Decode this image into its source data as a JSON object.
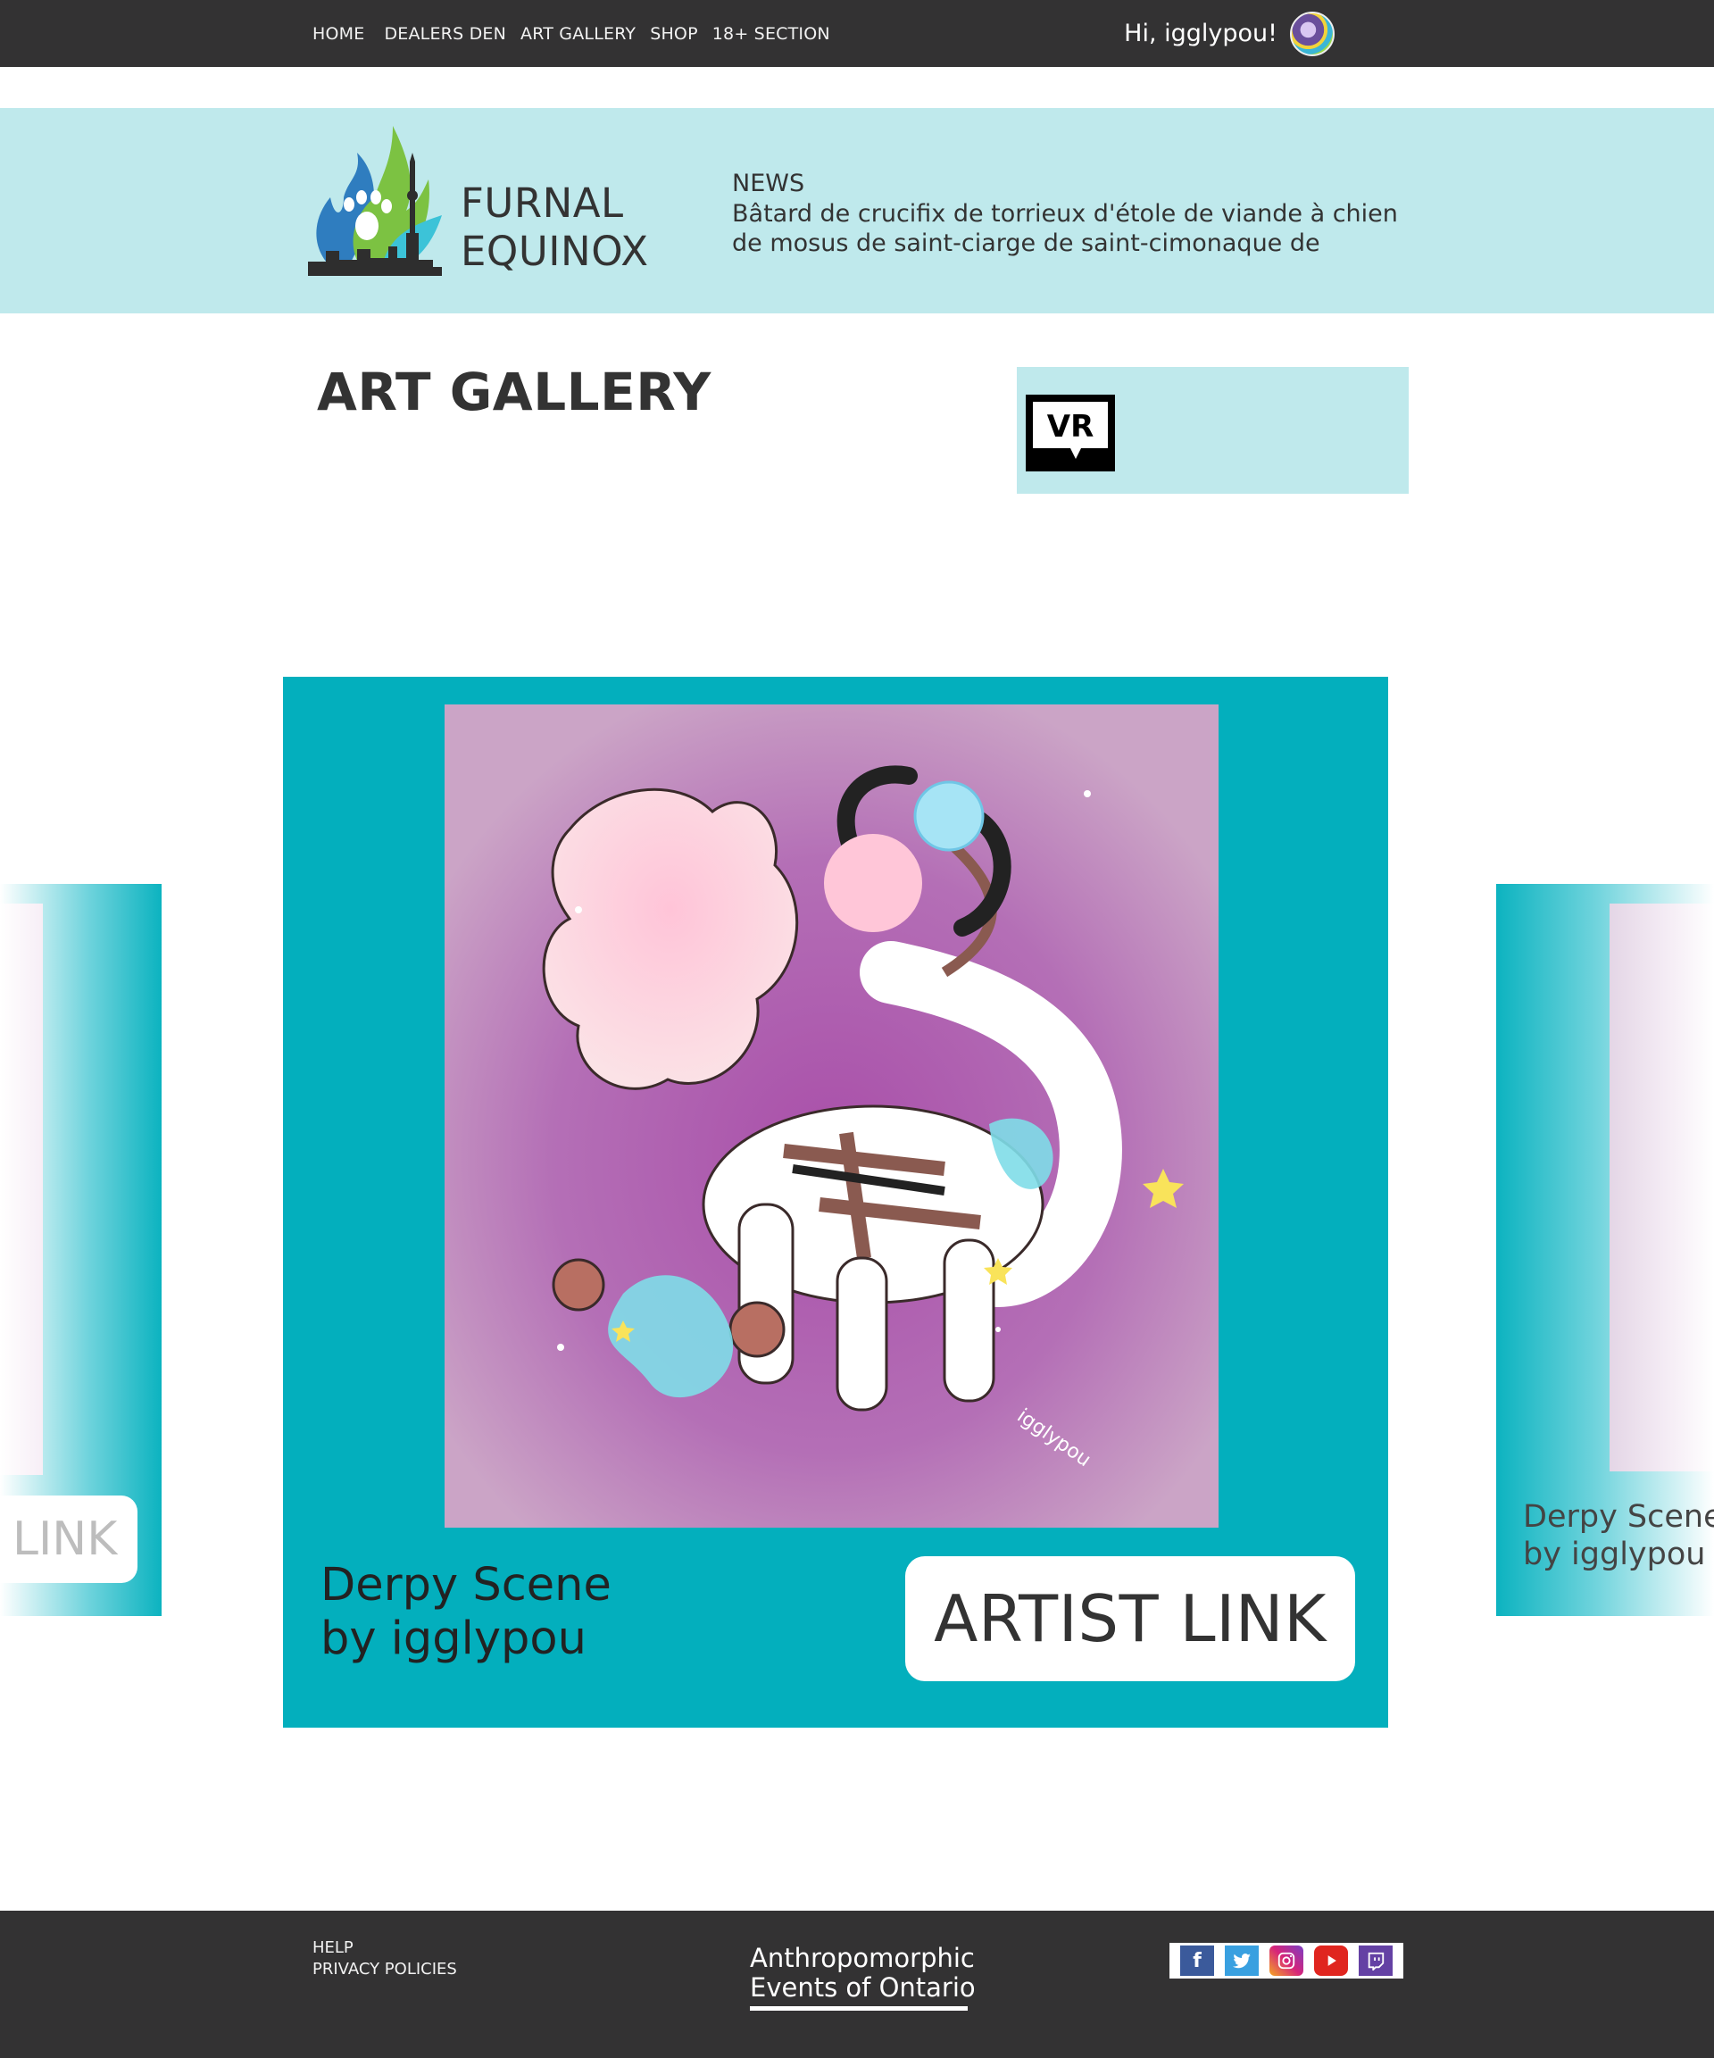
{
  "nav": {
    "items": [
      "HOME",
      "DEALERS DEN",
      "ART GALLERY",
      "SHOP",
      "18+ SECTION"
    ],
    "greeting": "Hi, igglypou!"
  },
  "header": {
    "brand_line1": "FURNAL",
    "brand_line2": "EQUINOX",
    "news_title": "NEWS",
    "news_body": "Bâtard de crucifix de torrieux d'étole de viande à chien de mosus de saint-ciarge de saint-cimonaque de"
  },
  "page": {
    "title": "ART GALLERY",
    "vr_label": "VR"
  },
  "carousel": {
    "current": {
      "title_line1": "Derpy Scene",
      "title_line2": "by igglypou",
      "artist_button": "ARTIST LINK",
      "signature": "igglypou"
    },
    "previous": {
      "button_partial": "LINK"
    },
    "next": {
      "title_line1": "Derpy Scene",
      "title_line2": "by igglypou"
    }
  },
  "footer": {
    "links": [
      "HELP",
      "PRIVACY POLICIES"
    ],
    "org_line1": "Anthropomorphic",
    "org_line2": "Events of Ontario",
    "social_icons": [
      "facebook-icon",
      "twitter-icon",
      "instagram-icon",
      "youtube-icon",
      "twitch-icon"
    ]
  },
  "colors": {
    "topbar": "#333233",
    "header_band": "#bfe9ec",
    "card_teal": "#03afbd",
    "art_background": "#c9a5c6"
  }
}
